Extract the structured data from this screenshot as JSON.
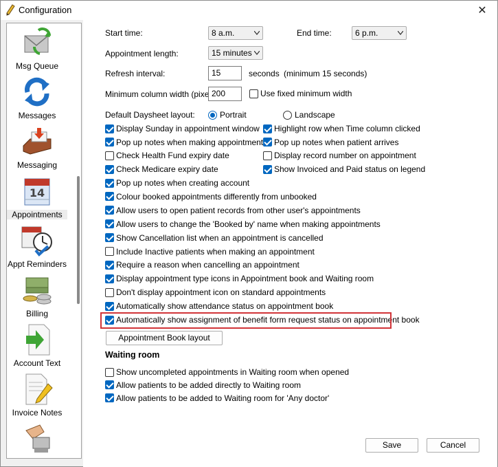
{
  "window": {
    "title": "Configuration",
    "close_glyph": "✕"
  },
  "sidebar": {
    "items": [
      {
        "label": "Msg Queue",
        "icon": "envelope-sync-icon"
      },
      {
        "label": "Messages",
        "icon": "sync-arrows-icon"
      },
      {
        "label": "Messaging",
        "icon": "inbox-tray-icon"
      },
      {
        "label": "Appointments",
        "icon": "calendar-icon",
        "selected": true
      },
      {
        "label": "Appt Reminders",
        "icon": "calendar-clock-icon"
      },
      {
        "label": "Billing",
        "icon": "money-stack-icon"
      },
      {
        "label": "Account Text",
        "icon": "document-arrow-icon"
      },
      {
        "label": "Invoice Notes",
        "icon": "document-pencil-icon"
      },
      {
        "label": "",
        "icon": "hand-card-icon"
      }
    ]
  },
  "settings": {
    "start_time_label": "Start time:",
    "start_time_value": "8 a.m.",
    "end_time_label": "End time:",
    "end_time_value": "6 p.m.",
    "appt_length_label": "Appointment length:",
    "appt_length_value": "15 minutes",
    "refresh_label": "Refresh interval:",
    "refresh_value": "15",
    "refresh_unit": "seconds",
    "refresh_note": "(minimum 15 seconds)",
    "min_col_label": "Minimum column width (pixels):",
    "min_col_value": "200",
    "fixed_min_width_label": "Use fixed minimum width",
    "daysheet_label": "Default Daysheet layout:",
    "portrait_label": "Portrait",
    "landscape_label": "Landscape"
  },
  "checks_left": [
    {
      "label": "Display Sunday in appointment window",
      "checked": true
    },
    {
      "label": "Pop up notes when making appointment",
      "checked": true
    },
    {
      "label": "Check Health Fund expiry date",
      "checked": false
    },
    {
      "label": "Check Medicare expiry date",
      "checked": true
    }
  ],
  "checks_right": [
    {
      "label": "Highlight row when Time column clicked",
      "checked": true
    },
    {
      "label": "Pop up notes when patient arrives",
      "checked": true
    },
    {
      "label": "Display record number on appointment",
      "checked": false
    },
    {
      "label": "Show Invoiced and Paid status on legend",
      "checked": true
    }
  ],
  "checks_full": [
    {
      "label": "Pop up notes when creating account",
      "checked": true
    },
    {
      "label": "Colour booked appointments differently from unbooked",
      "checked": true
    },
    {
      "label": "Allow users to open patient records from other user's appointments",
      "checked": true
    },
    {
      "label": "Allow users to change the 'Booked by' name when making appointments",
      "checked": true
    },
    {
      "label": "Show Cancellation list when an appointment is cancelled",
      "checked": true
    },
    {
      "label": "Include Inactive patients when making an appointment",
      "checked": false
    },
    {
      "label": "Require a reason when cancelling an appointment",
      "checked": true
    },
    {
      "label": "Display appointment type icons in Appointment book and Waiting room",
      "checked": true
    },
    {
      "label": "Don't display appointment icon on standard appointments",
      "checked": false
    },
    {
      "label": "Automatically show attendance status on appointment book",
      "checked": true
    },
    {
      "label": "Automatically show assignment of benefit form request status on appointment book",
      "checked": true
    }
  ],
  "appointment_book_layout_button": "Appointment Book layout",
  "waiting_room": {
    "title": "Waiting room",
    "checks": [
      {
        "label": "Show uncompleted appointments in Waiting room when opened",
        "checked": false
      },
      {
        "label": "Allow patients to be added directly to Waiting room",
        "checked": true
      },
      {
        "label": "Allow patients to be added to Waiting room for 'Any doctor'",
        "checked": true
      }
    ]
  },
  "footer": {
    "save_label": "Save",
    "cancel_label": "Cancel"
  },
  "colors": {
    "accent": "#0067c0",
    "highlight": "#d13438"
  }
}
